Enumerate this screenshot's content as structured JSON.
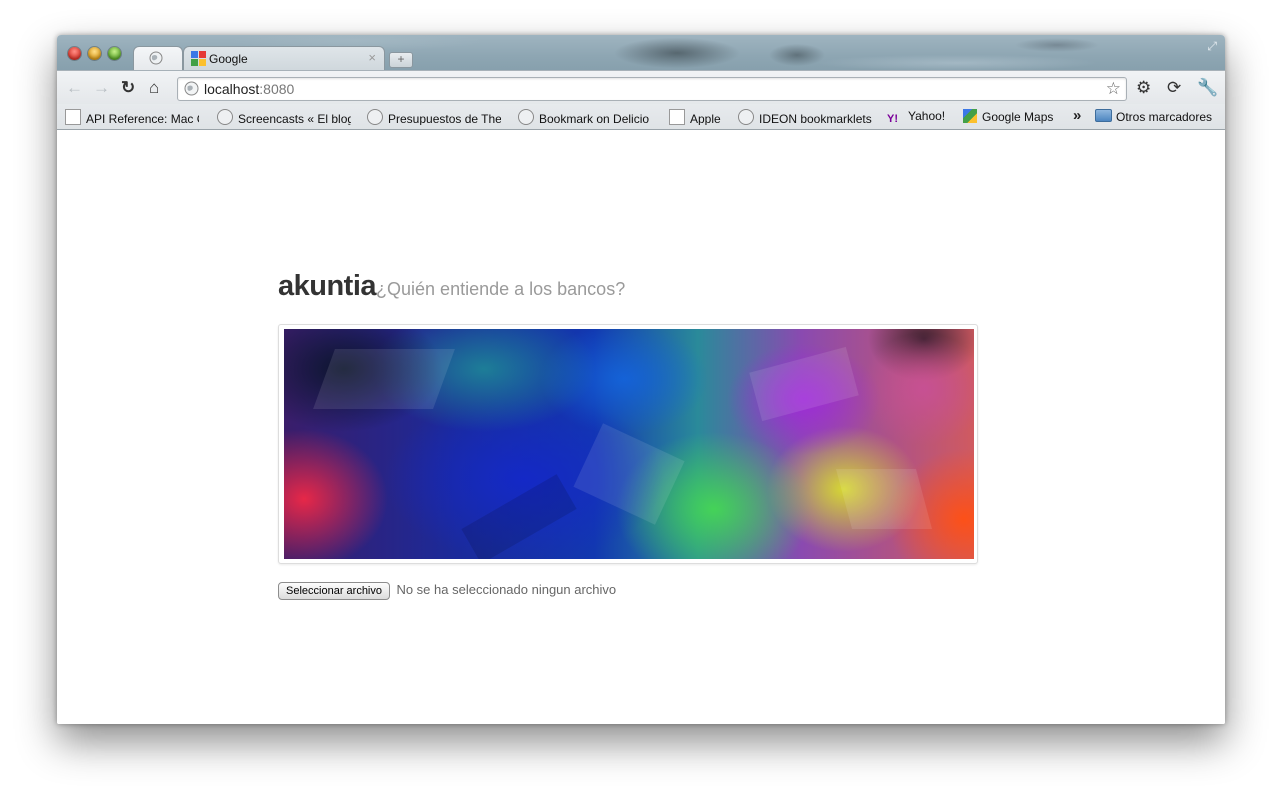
{
  "browser": {
    "tabs": [
      {
        "title": "",
        "icon": "globe-icon",
        "active": true
      },
      {
        "title": "Google",
        "icon": "google-icon",
        "active": false,
        "close": "×"
      }
    ],
    "new_tab_label": "+",
    "address": {
      "host": "localhost",
      "port": ":8080"
    },
    "bookmarks": [
      {
        "label": "API Reference: Mac C",
        "icon": "apple-page-icon"
      },
      {
        "label": "Screencasts « El blog",
        "icon": "globe-icon"
      },
      {
        "label": "Presupuestos de The",
        "icon": "globe-icon"
      },
      {
        "label": "Bookmark on Delicio",
        "icon": "globe-icon"
      },
      {
        "label": "Apple",
        "icon": "apple-page-icon"
      },
      {
        "label": "IDEON bookmarklets",
        "icon": "globe-icon"
      },
      {
        "label": "Yahoo!",
        "icon": "yahoo-icon"
      },
      {
        "label": "Google Maps",
        "icon": "google-maps-icon"
      }
    ],
    "more_bookmarks": "»",
    "other_bookmarks": "Otros marcadores"
  },
  "page": {
    "brand": "akuntia",
    "tagline": "¿Quién entiende a los bancos?",
    "file_input": {
      "button_label": "Seleccionar archivo",
      "status": "No se ha seleccionado ningun archivo"
    }
  }
}
